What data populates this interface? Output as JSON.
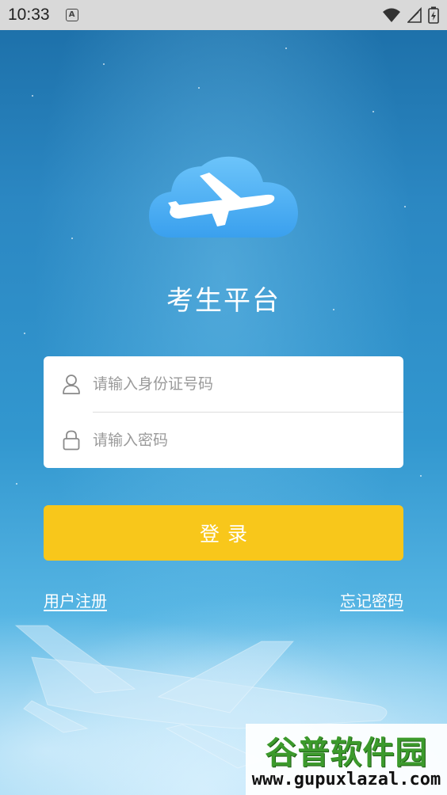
{
  "status_bar": {
    "time": "10:33",
    "icons": [
      "a-notification-icon",
      "wifi-icon",
      "signal-icon",
      "battery-icon"
    ]
  },
  "app": {
    "title": "考生平台",
    "logo_icon": "cloud-airplane-icon",
    "brand_color": "#42a5f0"
  },
  "login_form": {
    "id_field": {
      "placeholder": "请输入身份证号码",
      "value": "",
      "icon": "user-icon"
    },
    "password_field": {
      "placeholder": "请输入密码",
      "value": "",
      "icon": "lock-icon"
    },
    "login_button": "登录",
    "login_button_color": "#f8c71b"
  },
  "links": {
    "register": "用户注册",
    "forgot_password": "忘记密码"
  },
  "watermark": {
    "logo_text": "谷普软件园",
    "url": "www.gupuxlazal.com"
  }
}
